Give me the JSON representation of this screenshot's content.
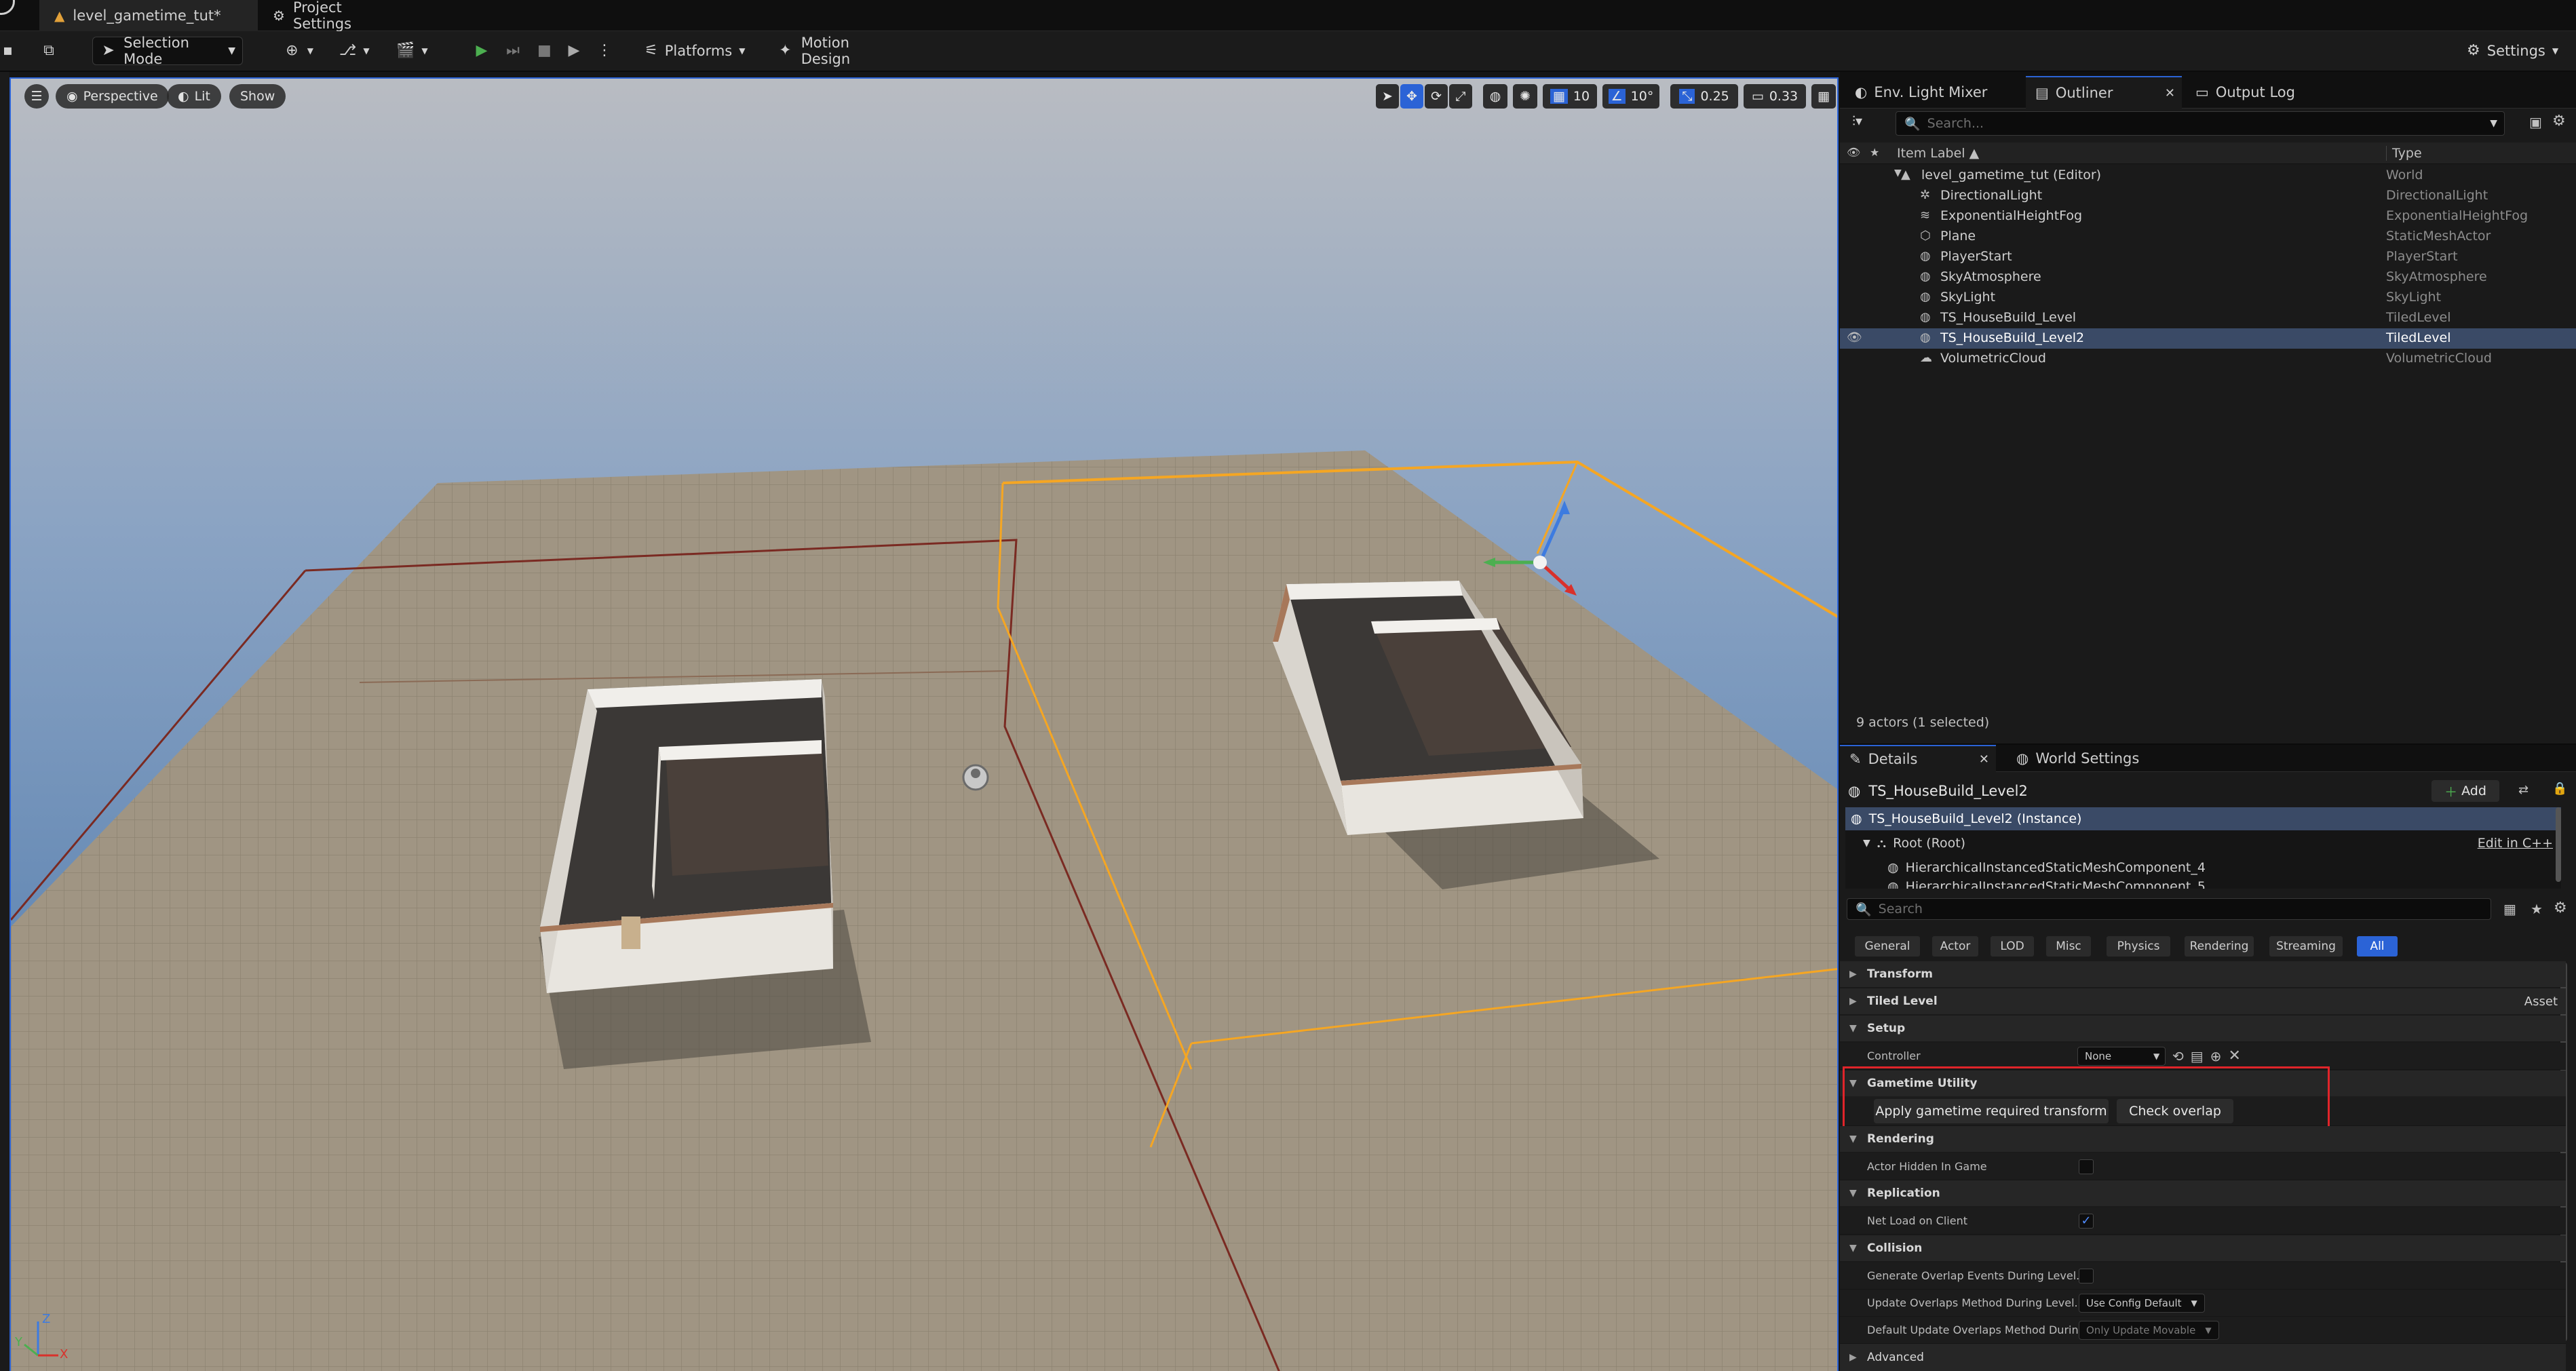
{
  "tabs": {
    "level": "level_gametime_tut*",
    "project_settings": "Project Settings"
  },
  "toolbar": {
    "selection_mode": "Selection Mode",
    "platforms": "Platforms",
    "motion_design": "Motion Design",
    "settings": "Settings"
  },
  "viewport": {
    "perspective": "Perspective",
    "lit": "Lit",
    "show": "Show",
    "grid_snap": "10",
    "rotation_snap": "10°",
    "scale_snap": "0.25",
    "camera_speed": "0.33",
    "axis_z": "Z",
    "axis_y": "Y",
    "axis_x": "X"
  },
  "right_tabs": {
    "env_light_mixer": "Env. Light Mixer",
    "outliner": "Outliner",
    "output_log": "Output Log"
  },
  "outliner": {
    "search_placeholder": "Search...",
    "col_label": "Item Label ▲",
    "col_type": "Type",
    "items": [
      {
        "label": "level_gametime_tut (Editor)",
        "type": "World"
      },
      {
        "label": "DirectionalLight",
        "type": "DirectionalLight"
      },
      {
        "label": "ExponentialHeightFog",
        "type": "ExponentialHeightFog"
      },
      {
        "label": "Plane",
        "type": "StaticMeshActor"
      },
      {
        "label": "PlayerStart",
        "type": "PlayerStart"
      },
      {
        "label": "SkyAtmosphere",
        "type": "SkyAtmosphere"
      },
      {
        "label": "SkyLight",
        "type": "SkyLight"
      },
      {
        "label": "TS_HouseBuild_Level",
        "type": "TiledLevel"
      },
      {
        "label": "TS_HouseBuild_Level2",
        "type": "TiledLevel"
      },
      {
        "label": "VolumetricCloud",
        "type": "VolumetricCloud"
      }
    ],
    "footer": "9 actors (1 selected)"
  },
  "details": {
    "tab_details": "Details",
    "tab_world_settings": "World Settings",
    "actor_name": "TS_HouseBuild_Level2",
    "add_label": "Add",
    "instance_label": "TS_HouseBuild_Level2 (Instance)",
    "root_label": "Root (Root)",
    "edit_cpp": "Edit in C++",
    "component_1": "HierarchicalInstancedStaticMeshComponent_4",
    "component_2": "HierarchicalInstancedStaticMeshComponent_5",
    "search_placeholder": "Search",
    "categories": [
      "General",
      "Actor",
      "LOD",
      "Misc",
      "Physics",
      "Rendering",
      "Streaming",
      "All"
    ],
    "sections": {
      "transform": "Transform",
      "tiled_level": "Tiled Level",
      "asset": "Asset",
      "setup": "Setup",
      "gametime_utility": "Gametime Utility",
      "rendering": "Rendering",
      "replication": "Replication",
      "collision": "Collision",
      "advanced": "Advanced"
    },
    "props": {
      "controller": "Controller",
      "controller_value": "None",
      "apply_transform": "Apply gametime required transform",
      "check_overlap": "Check overlap",
      "actor_hidden": "Actor Hidden In Game",
      "net_load": "Net Load on Client",
      "gen_overlap": "Generate Overlap Events During Level...",
      "update_overlaps": "Update Overlaps Method During Level...",
      "update_overlaps_value": "Use Config Default",
      "default_update": "Default Update Overlaps Method Durin...",
      "default_update_value": "Only Update Movable"
    }
  },
  "colors": {
    "accent": "#2b63d6",
    "selection_row": "#3a4a66",
    "highlight_box": "#e0242a",
    "play_green": "#4caf50"
  }
}
